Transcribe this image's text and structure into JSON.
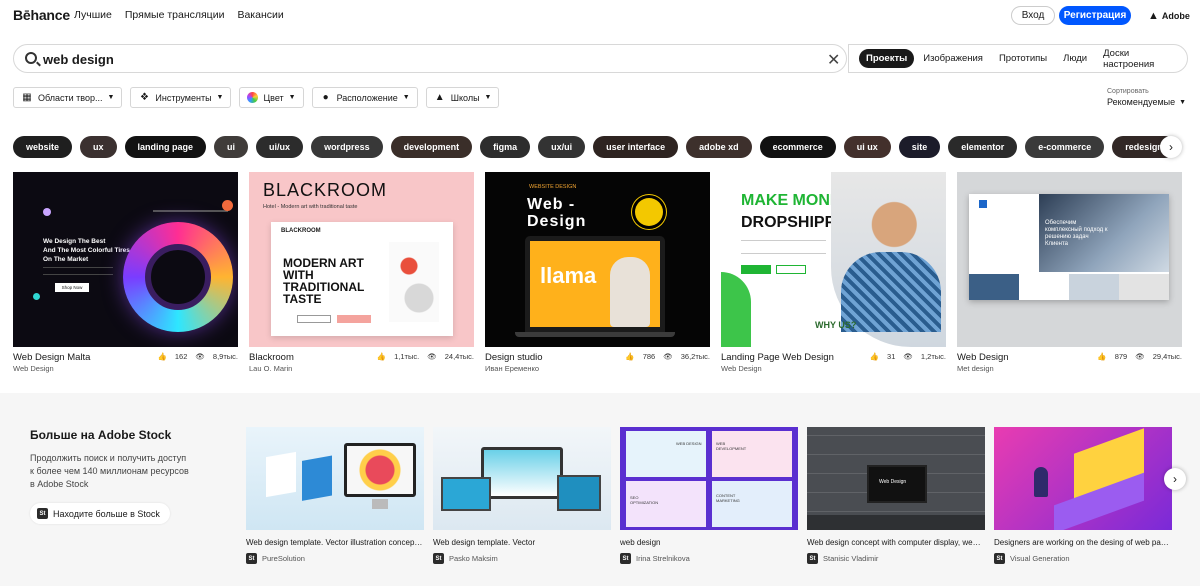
{
  "brand": {
    "logo": "Bēhance",
    "adobe": "Adobe",
    "accent": "#0057ff"
  },
  "nav": {
    "items": [
      "Лучшие",
      "Прямые трансляции",
      "Вакансии"
    ],
    "login": "Вход",
    "register": "Регистрация"
  },
  "search": {
    "value": "web design"
  },
  "tabs": [
    {
      "label": "Проекты",
      "active": true
    },
    {
      "label": "Изображения",
      "active": false
    },
    {
      "label": "Прототипы",
      "active": false
    },
    {
      "label": "Люди",
      "active": false
    },
    {
      "label": "Доски настроения",
      "active": false
    }
  ],
  "filters": [
    {
      "label": "Области твор...",
      "icon": "grid-icon"
    },
    {
      "label": "Инструменты",
      "icon": "tools-icon"
    },
    {
      "label": "Цвет",
      "icon": "color-wheel-icon"
    },
    {
      "label": "Расположение",
      "icon": "location-pin-icon"
    },
    {
      "label": "Школы",
      "icon": "graduation-cap-icon"
    }
  ],
  "sort": {
    "label": "Сортировать",
    "value": "Рекомендуемые"
  },
  "tags": [
    "website",
    "ux",
    "landing page",
    "ui",
    "ui/ux",
    "wordpress",
    "development",
    "figma",
    "ux/ui",
    "user interface",
    "adobe xd",
    "ecommerce",
    "ui ux",
    "site",
    "elementor",
    "e-commerce",
    "redesign"
  ],
  "projects": [
    {
      "title": "Web Design Malta",
      "author": "Web Design",
      "likes": "162",
      "views": "8,9тыс."
    },
    {
      "title": "Blackroom",
      "author": "Lau O. Marin",
      "likes": "1,1тыс.",
      "views": "24,4тыс."
    },
    {
      "title": "Design studio",
      "author": "Иван Еременко",
      "likes": "786",
      "views": "36,2тыс."
    },
    {
      "title": "Landing Page Web Design",
      "author": "Web Design",
      "likes": "31",
      "views": "1,2тыс."
    },
    {
      "title": "Web Design",
      "author": "Met design",
      "likes": "879",
      "views": "29,4тыс."
    }
  ],
  "thumb_text": {
    "malta": {
      "headline1": "We Design The Best",
      "headline2": "And The Most Colorful Tires",
      "headline3": "On The Market",
      "button": "Shop Now"
    },
    "blackroom": {
      "logo": "BLACKROOM",
      "tagline": "Hotel - Modern art with traditional taste",
      "inner_logo": "BLACKROOM",
      "headline": "MODERN ART WITH TRADITIONAL TASTE"
    },
    "studio": {
      "small": "WEBSITE DESIGN",
      "big1": "Web -",
      "big2": "Design",
      "screen": "llama"
    },
    "money": {
      "line1": "MAKE MONEY",
      "line2": "DROPSHIPPING",
      "why": "WHY US?"
    },
    "consult": {
      "text": "Обеспечим комплексный подход к решению задач Клиента"
    }
  },
  "stock": {
    "title": "Больше на Adobe Stock",
    "desc": "Продолжить поиск и получить доступ к более чем 140 миллионам ресурсов в Adobe Stock",
    "button": "Находите больше в Stock",
    "badge": "St",
    "items": [
      {
        "title": "Web design template. Vector illustration concept ...",
        "author": "PureSolution"
      },
      {
        "title": "Web design template. Vector",
        "author": "Pasko Maksim"
      },
      {
        "title": "web design",
        "author": "Irina Strelnikova"
      },
      {
        "title": "Web design concept with computer display, web t...",
        "author": "Stanisic Vladimir"
      },
      {
        "title": "Designers are working on the desing of web page....",
        "author": "Visual Generation"
      }
    ],
    "thumb_labels": [
      "WEB DESIGN",
      "WEB DEVELOPMENT",
      "SEO OPTIMIZATION",
      "CONTENT MARKETING",
      "Web Design"
    ]
  }
}
